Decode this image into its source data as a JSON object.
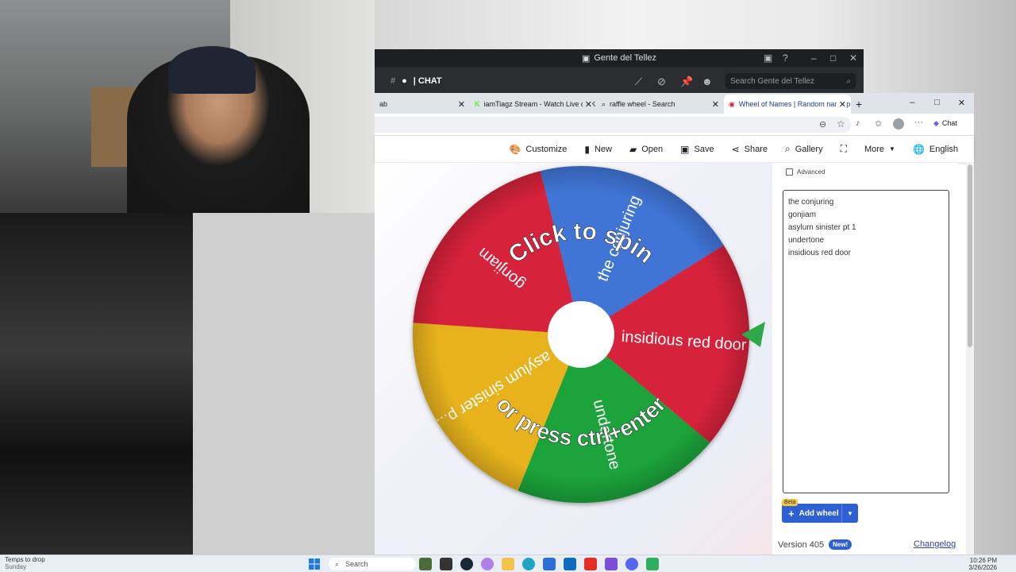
{
  "discord": {
    "title": "Gente del Tellez",
    "channel": "| CHAT",
    "search_placeholder": "Search Gente del Tellez"
  },
  "browser": {
    "tabs": [
      {
        "label": "ab",
        "active": false
      },
      {
        "label": "iamTiagz Stream - Watch Live on K",
        "active": false
      },
      {
        "label": "raffle wheel - Search",
        "active": false
      },
      {
        "label": "Wheel of Names | Random name p",
        "active": true
      }
    ],
    "chat_button": "Chat"
  },
  "toolbar": {
    "customize": "Customize",
    "new": "New",
    "open": "Open",
    "save": "Save",
    "share": "Share",
    "gallery": "Gallery",
    "more": "More",
    "language": "English"
  },
  "wheel": {
    "prompt_top": "Click to spin",
    "prompt_bottom": "or press ctrl+enter",
    "segments": [
      {
        "label": "the conjuring",
        "color": "#3f74d6"
      },
      {
        "label": "insidious red door",
        "color": "#d6213a"
      },
      {
        "label": "undertone",
        "color": "#1fa33b"
      },
      {
        "label": "asylum sinister p...",
        "color": "#e7b21f"
      },
      {
        "label": "gonjiam",
        "color": "#d6213a"
      }
    ],
    "pointer_color": "#2fa84a"
  },
  "panel": {
    "advanced_label": "Advanced",
    "entries": [
      "the conjuring",
      "gonjiam",
      "asylum sinister pt 1",
      "undertone",
      "insidious red door"
    ],
    "beta_badge": "Beta",
    "add_wheel_label": "Add wheel",
    "version": "Version 405",
    "new_badge": "New!",
    "changelog": "Changelog"
  },
  "taskbar": {
    "weather_line1": "Temps to drop",
    "weather_line2": "Sunday",
    "search_label": "Search",
    "time": "10:26 PM",
    "date": "3/26/2026"
  }
}
